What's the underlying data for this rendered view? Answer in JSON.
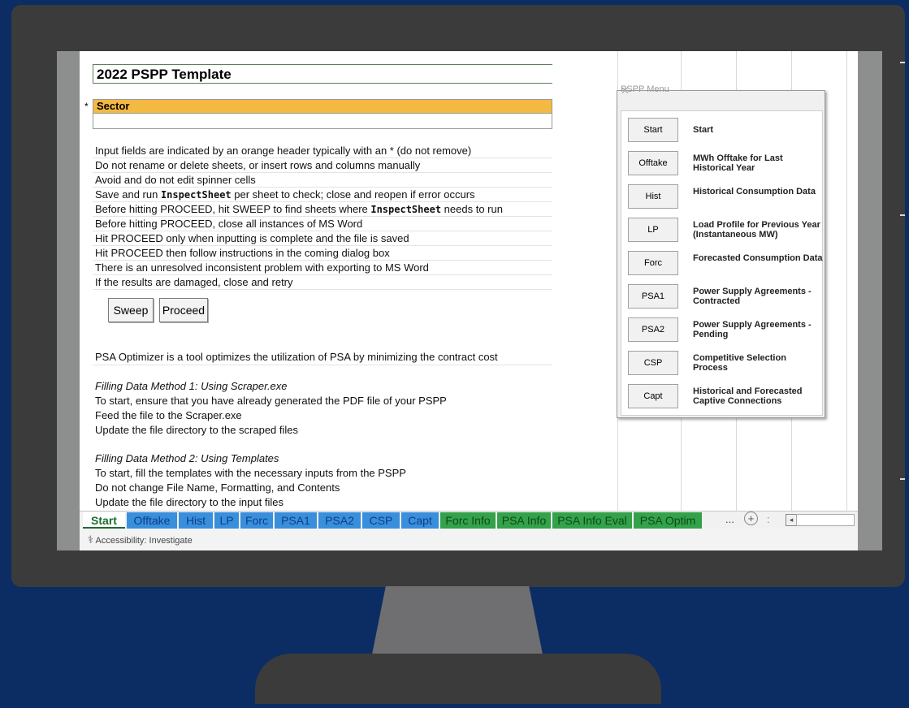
{
  "sheet": {
    "title": "2022 PSPP Template",
    "sector_marker": "*",
    "sector_label": "Sector",
    "instructions": [
      {
        "pre": "Input fields are indicated by an orange header typically with an * (do not remove)",
        "code": "",
        "post": ""
      },
      {
        "pre": "Do not rename or delete sheets, or insert rows and columns manually",
        "code": "",
        "post": ""
      },
      {
        "pre": "Avoid and do not edit spinner cells",
        "code": "",
        "post": ""
      },
      {
        "pre": "Save and run ",
        "code": "InspectSheet",
        "post": " per sheet to check; close and reopen if error occurs"
      },
      {
        "pre": "Before hitting PROCEED, hit SWEEP to find sheets where ",
        "code": "InspectSheet",
        "post": " needs to run"
      },
      {
        "pre": "Before hitting PROCEED, close all instances of MS Word",
        "code": "",
        "post": ""
      },
      {
        "pre": "Hit PROCEED only when inputting is complete and the file is saved",
        "code": "",
        "post": ""
      },
      {
        "pre": "Hit PROCEED then follow instructions in the coming dialog box",
        "code": "",
        "post": ""
      },
      {
        "pre": "There is an unresolved inconsistent problem with exporting to MS Word",
        "code": "",
        "post": ""
      },
      {
        "pre": "If the results are damaged, close and retry",
        "code": "",
        "post": ""
      }
    ],
    "sweep_label": "Sweep",
    "proceed_label": "Proceed",
    "optimizer_note": "PSA Optimizer is a tool optimizes the utilization of PSA by minimizing the contract cost",
    "method1": {
      "heading": "Filling Data Method 1: Using Scraper.exe",
      "lines": [
        "To start, ensure that you have already generated the PDF file of your PSPP",
        "Feed the file to the Scraper.exe",
        "Update the file directory to the scraped files"
      ]
    },
    "method2": {
      "heading": "Filling Data Method 2: Using Templates",
      "lines": [
        "To start, fill the templates with the necessary inputs from the PSPP",
        "Do not change File Name, Formatting, and Contents",
        "Update the file directory to the input files"
      ]
    }
  },
  "tabs": [
    {
      "label": "Start",
      "kind": "active"
    },
    {
      "label": "Offtake",
      "kind": "blue"
    },
    {
      "label": "Hist",
      "kind": "blue"
    },
    {
      "label": "LP",
      "kind": "blue"
    },
    {
      "label": "Forc",
      "kind": "blue"
    },
    {
      "label": "PSA1",
      "kind": "blue"
    },
    {
      "label": "PSA2",
      "kind": "blue"
    },
    {
      "label": "CSP",
      "kind": "blue"
    },
    {
      "label": "Capt",
      "kind": "blue"
    },
    {
      "label": "Forc Info",
      "kind": "green"
    },
    {
      "label": "PSA Info",
      "kind": "green"
    },
    {
      "label": "PSA Info Eval",
      "kind": "green"
    },
    {
      "label": "PSA Optim",
      "kind": "green"
    }
  ],
  "tabbar": {
    "more": "...",
    "add": "+",
    "dots": ":",
    "scroll_left": "◂"
  },
  "status": {
    "accessibility": "Accessibility: Investigate"
  },
  "dialog": {
    "title": "PSPP Menu",
    "close": "✕",
    "items": [
      {
        "button": "Start",
        "label": "Start"
      },
      {
        "button": "Offtake",
        "label": "MWh Offtake for Last Historical Year"
      },
      {
        "button": "Hist",
        "label": "Historical Consumption Data"
      },
      {
        "button": "LP",
        "label": "Load Profile for Previous Year (Instantaneous MW)"
      },
      {
        "button": "Forc",
        "label": "Forecasted Consumption Data"
      },
      {
        "button": "PSA1",
        "label": "Power Supply Agreements - Contracted"
      },
      {
        "button": "PSA2",
        "label": "Power Supply Agreements - Pending"
      },
      {
        "button": "CSP",
        "label": "Competitive Selection Process"
      },
      {
        "button": "Capt",
        "label": "Historical and Forecasted Captive Connections"
      }
    ]
  }
}
